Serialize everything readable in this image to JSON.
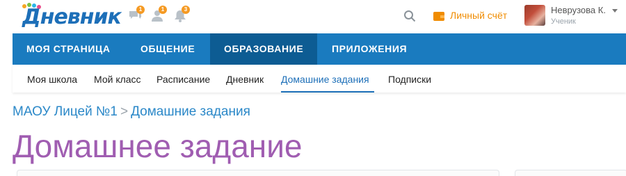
{
  "header": {
    "logo_text": "Дневник",
    "notifications": [
      {
        "icon": "messages-icon",
        "count": "1"
      },
      {
        "icon": "friends-icon",
        "count": "1"
      },
      {
        "icon": "bell-icon",
        "count": "3"
      }
    ],
    "wallet_label": "Личный счёт",
    "user": {
      "name": "Неврузова К.",
      "role": "Ученик"
    }
  },
  "main_nav": {
    "items": [
      {
        "label": "МОЯ СТРАНИЦА"
      },
      {
        "label": "ОБЩЕНИЕ"
      },
      {
        "label": "ОБРАЗОВАНИЕ"
      },
      {
        "label": "ПРИЛОЖЕНИЯ"
      }
    ],
    "active": "ОБРАЗОВАНИЕ"
  },
  "sub_nav": {
    "items": [
      {
        "label": "Моя школа"
      },
      {
        "label": "Мой класс"
      },
      {
        "label": "Расписание"
      },
      {
        "label": "Дневник"
      },
      {
        "label": "Домашние задания"
      },
      {
        "label": "Подписки"
      }
    ],
    "active": "Домашние задания"
  },
  "breadcrumb": {
    "school": "МАОУ Лицей №1",
    "separator": ">",
    "section": "Домашние задания"
  },
  "page_title": "Домашнее задание",
  "colors": {
    "brand_blue": "#1a7bbf",
    "nav_active": "#0d5c93",
    "accent_orange": "#f08c00",
    "title_purple": "#a05db1",
    "link_blue": "#2b88c8"
  }
}
